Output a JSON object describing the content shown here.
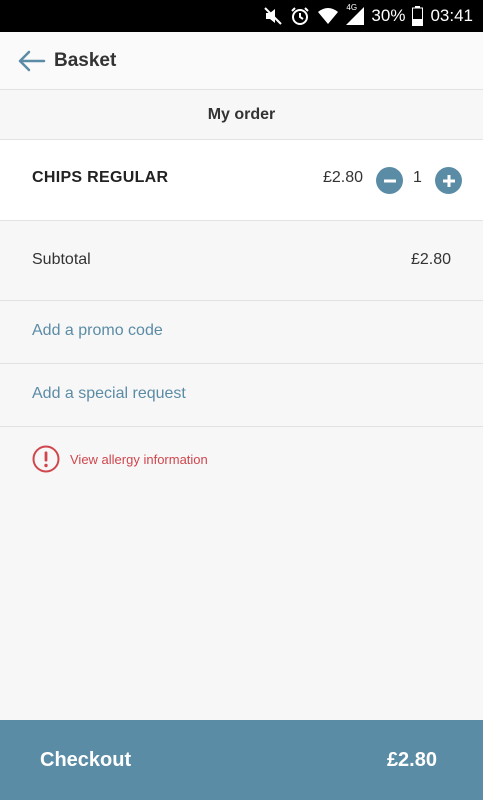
{
  "status_bar": {
    "battery": "30%",
    "time": "03:41",
    "network": "4G"
  },
  "app_bar": {
    "title": "Basket",
    "back_icon": "arrow-left-icon"
  },
  "section": {
    "title": "My order"
  },
  "items": [
    {
      "name": "CHIPS REGULAR",
      "price": "£2.80",
      "quantity": "1"
    }
  ],
  "subtotal": {
    "label": "Subtotal",
    "value": "£2.80"
  },
  "links": {
    "promo": "Add a promo code",
    "special_request": "Add a special request"
  },
  "allergy": {
    "text": "View allergy information",
    "icon": "alert-circle-icon"
  },
  "checkout": {
    "label": "Checkout",
    "total": "£2.80"
  },
  "colors": {
    "accent": "#5b8ca6",
    "alert": "#d0464d"
  }
}
